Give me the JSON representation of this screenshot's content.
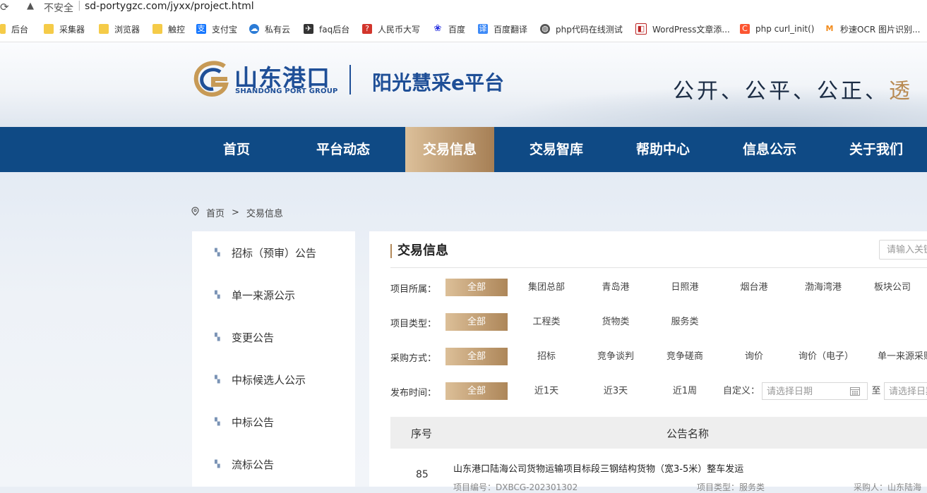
{
  "browser": {
    "insecure_label": "不安全",
    "url": "sd-portygzc.com/jyxx/project.html",
    "bookmarks": [
      {
        "label": "后台",
        "icon": "folder-icon"
      },
      {
        "label": "采集器",
        "icon": "folder-icon"
      },
      {
        "label": "浏览器",
        "icon": "folder-icon"
      },
      {
        "label": "触控",
        "icon": "folder-icon"
      },
      {
        "label": "支付宝",
        "icon": "alipay-icon"
      },
      {
        "label": "私有云",
        "icon": "cloud-icon"
      },
      {
        "label": "faq后台",
        "icon": "bird-icon"
      },
      {
        "label": "人民币大写",
        "icon": "rmb-icon"
      },
      {
        "label": "百度",
        "icon": "baidu-paw-icon"
      },
      {
        "label": "百度翻译",
        "icon": "translate-icon"
      },
      {
        "label": "php代码在线测试",
        "icon": "globe-icon"
      },
      {
        "label": "WordPress文章添...",
        "icon": "wordpress-icon"
      },
      {
        "label": "php curl_init()",
        "icon": "csdn-icon"
      },
      {
        "label": "秒速OCR 图片识别...",
        "icon": "ocr-icon"
      }
    ]
  },
  "header": {
    "logo_cn": "山东港口",
    "logo_en": "SHANDONG PORT GROUP",
    "platform": "阳光慧采e平台",
    "slogan": "公开、公平、公正、",
    "slogan_last": "透"
  },
  "nav": {
    "items": [
      "首页",
      "平台动态",
      "交易信息",
      "交易智库",
      "帮助中心",
      "信息公示",
      "关于我们"
    ],
    "active": "交易信息"
  },
  "breadcrumb": {
    "home": "首页",
    "sep": ">",
    "current": "交易信息"
  },
  "sidebar": {
    "items": [
      "招标（预审）公告",
      "单一来源公示",
      "变更公告",
      "中标候选人公示",
      "中标公告",
      "流标公告"
    ]
  },
  "main": {
    "title": "交易信息",
    "search_placeholder": "请输入关键字",
    "filters": {
      "affiliation": {
        "label": "项目所属：",
        "all": "全部",
        "options": [
          "集团总部",
          "青岛港",
          "日照港",
          "烟台港",
          "渤海湾港",
          "板块公司"
        ]
      },
      "type": {
        "label": "项目类型：",
        "all": "全部",
        "options": [
          "工程类",
          "货物类",
          "服务类"
        ]
      },
      "method": {
        "label": "采购方式：",
        "all": "全部",
        "options": [
          "招标",
          "竞争谈判",
          "竞争磋商",
          "询价",
          "询价（电子）",
          "单一来源采购"
        ]
      },
      "time": {
        "label": "发布时间：",
        "all": "全部",
        "options": [
          "近1天",
          "近3天",
          "近1周"
        ],
        "custom_label": "自定义：",
        "date_placeholder": "请选择日期",
        "to_label": "至"
      }
    },
    "table": {
      "headers": [
        "序号",
        "公告名称"
      ],
      "rows": [
        {
          "no": "85",
          "title": "山东港口陆海公司货物运输项目标段三钢结构货物（宽3-5米）整车发运",
          "code": "项目编号：DXBCG-202301302",
          "category": "项目类型：服务类",
          "buyer": "采购人：山东陆海"
        }
      ]
    }
  }
}
